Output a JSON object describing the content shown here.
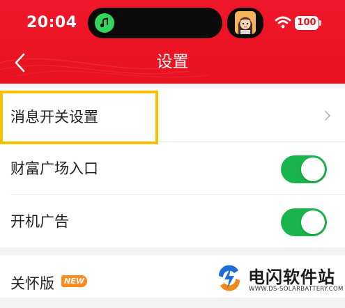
{
  "status_bar": {
    "time": "20:04",
    "battery": "100"
  },
  "header": {
    "title": "设置"
  },
  "settings": {
    "rows": [
      {
        "label": "消息开关设置"
      },
      {
        "label": "财富广场入口",
        "toggle_on": true
      },
      {
        "label": "开机广告",
        "toggle_on": true
      }
    ],
    "care_mode": {
      "label": "关怀版",
      "badge": "NEW"
    }
  },
  "watermark": {
    "title": "电闪软件站",
    "url": "WWW.DS-SOLARBATTERY.COM"
  },
  "colors": {
    "header_red": "#e8121f",
    "toggle_green": "#19b44b",
    "highlight_yellow": "#f7c100",
    "badge_orange": "#ff8a1f"
  },
  "icons": [
    "music-note-icon",
    "avatar-image",
    "wifi-icon",
    "battery-icon",
    "back-arrow-icon",
    "chevron-right-icon"
  ]
}
